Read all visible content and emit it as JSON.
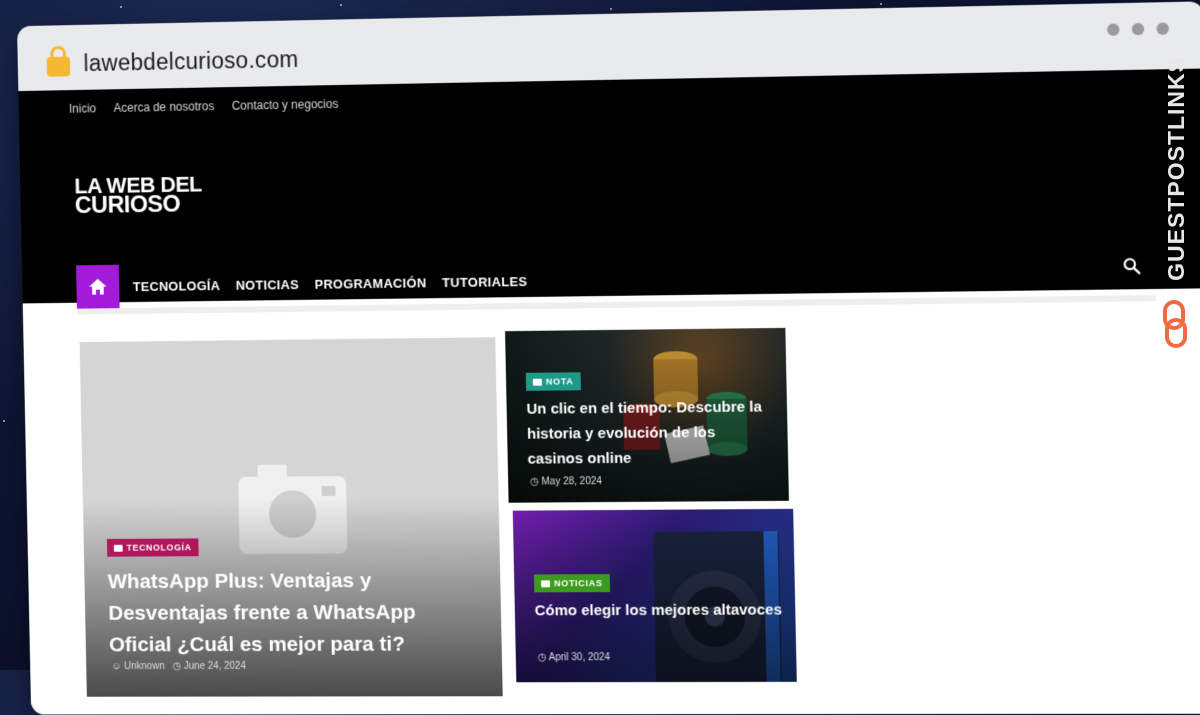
{
  "browser": {
    "url": "lawebdelcurioso.com"
  },
  "site": {
    "top_nav": [
      "Inicio",
      "Acerca de nosotros",
      "Contacto y negocios"
    ],
    "logo_line1": "LA WEB DEL",
    "logo_line2": "CURIOSO",
    "main_nav": [
      "TECNOLOGÍA",
      "NOTICIAS",
      "PROGRAMACIÓN",
      "TUTORIALES"
    ]
  },
  "featured": {
    "category": "TECNOLOGÍA",
    "title": "WhatsApp Plus: Ventajas y Desventajas frente a WhatsApp Oficial ¿Cuál es mejor para ti?",
    "author": "Unknown",
    "date": "June 24, 2024"
  },
  "cards": [
    {
      "category": "NOTA",
      "title": "Un clic en el tiempo: Descubre la historia y evolución de los casinos online",
      "date": "May 28, 2024"
    },
    {
      "category": "NOTICIAS",
      "title": "Cómo elegir los mejores altavoces",
      "date": "April 30, 2024"
    }
  ],
  "watermark": "GUESTPOSTLINKS",
  "colors": {
    "home_button": "#a31bd8",
    "badge_tecnologia": "#b0185b",
    "badge_nota": "#1f9a8a",
    "badge_noticias": "#3c9a1f",
    "watermark_accent": "#f06a43"
  }
}
